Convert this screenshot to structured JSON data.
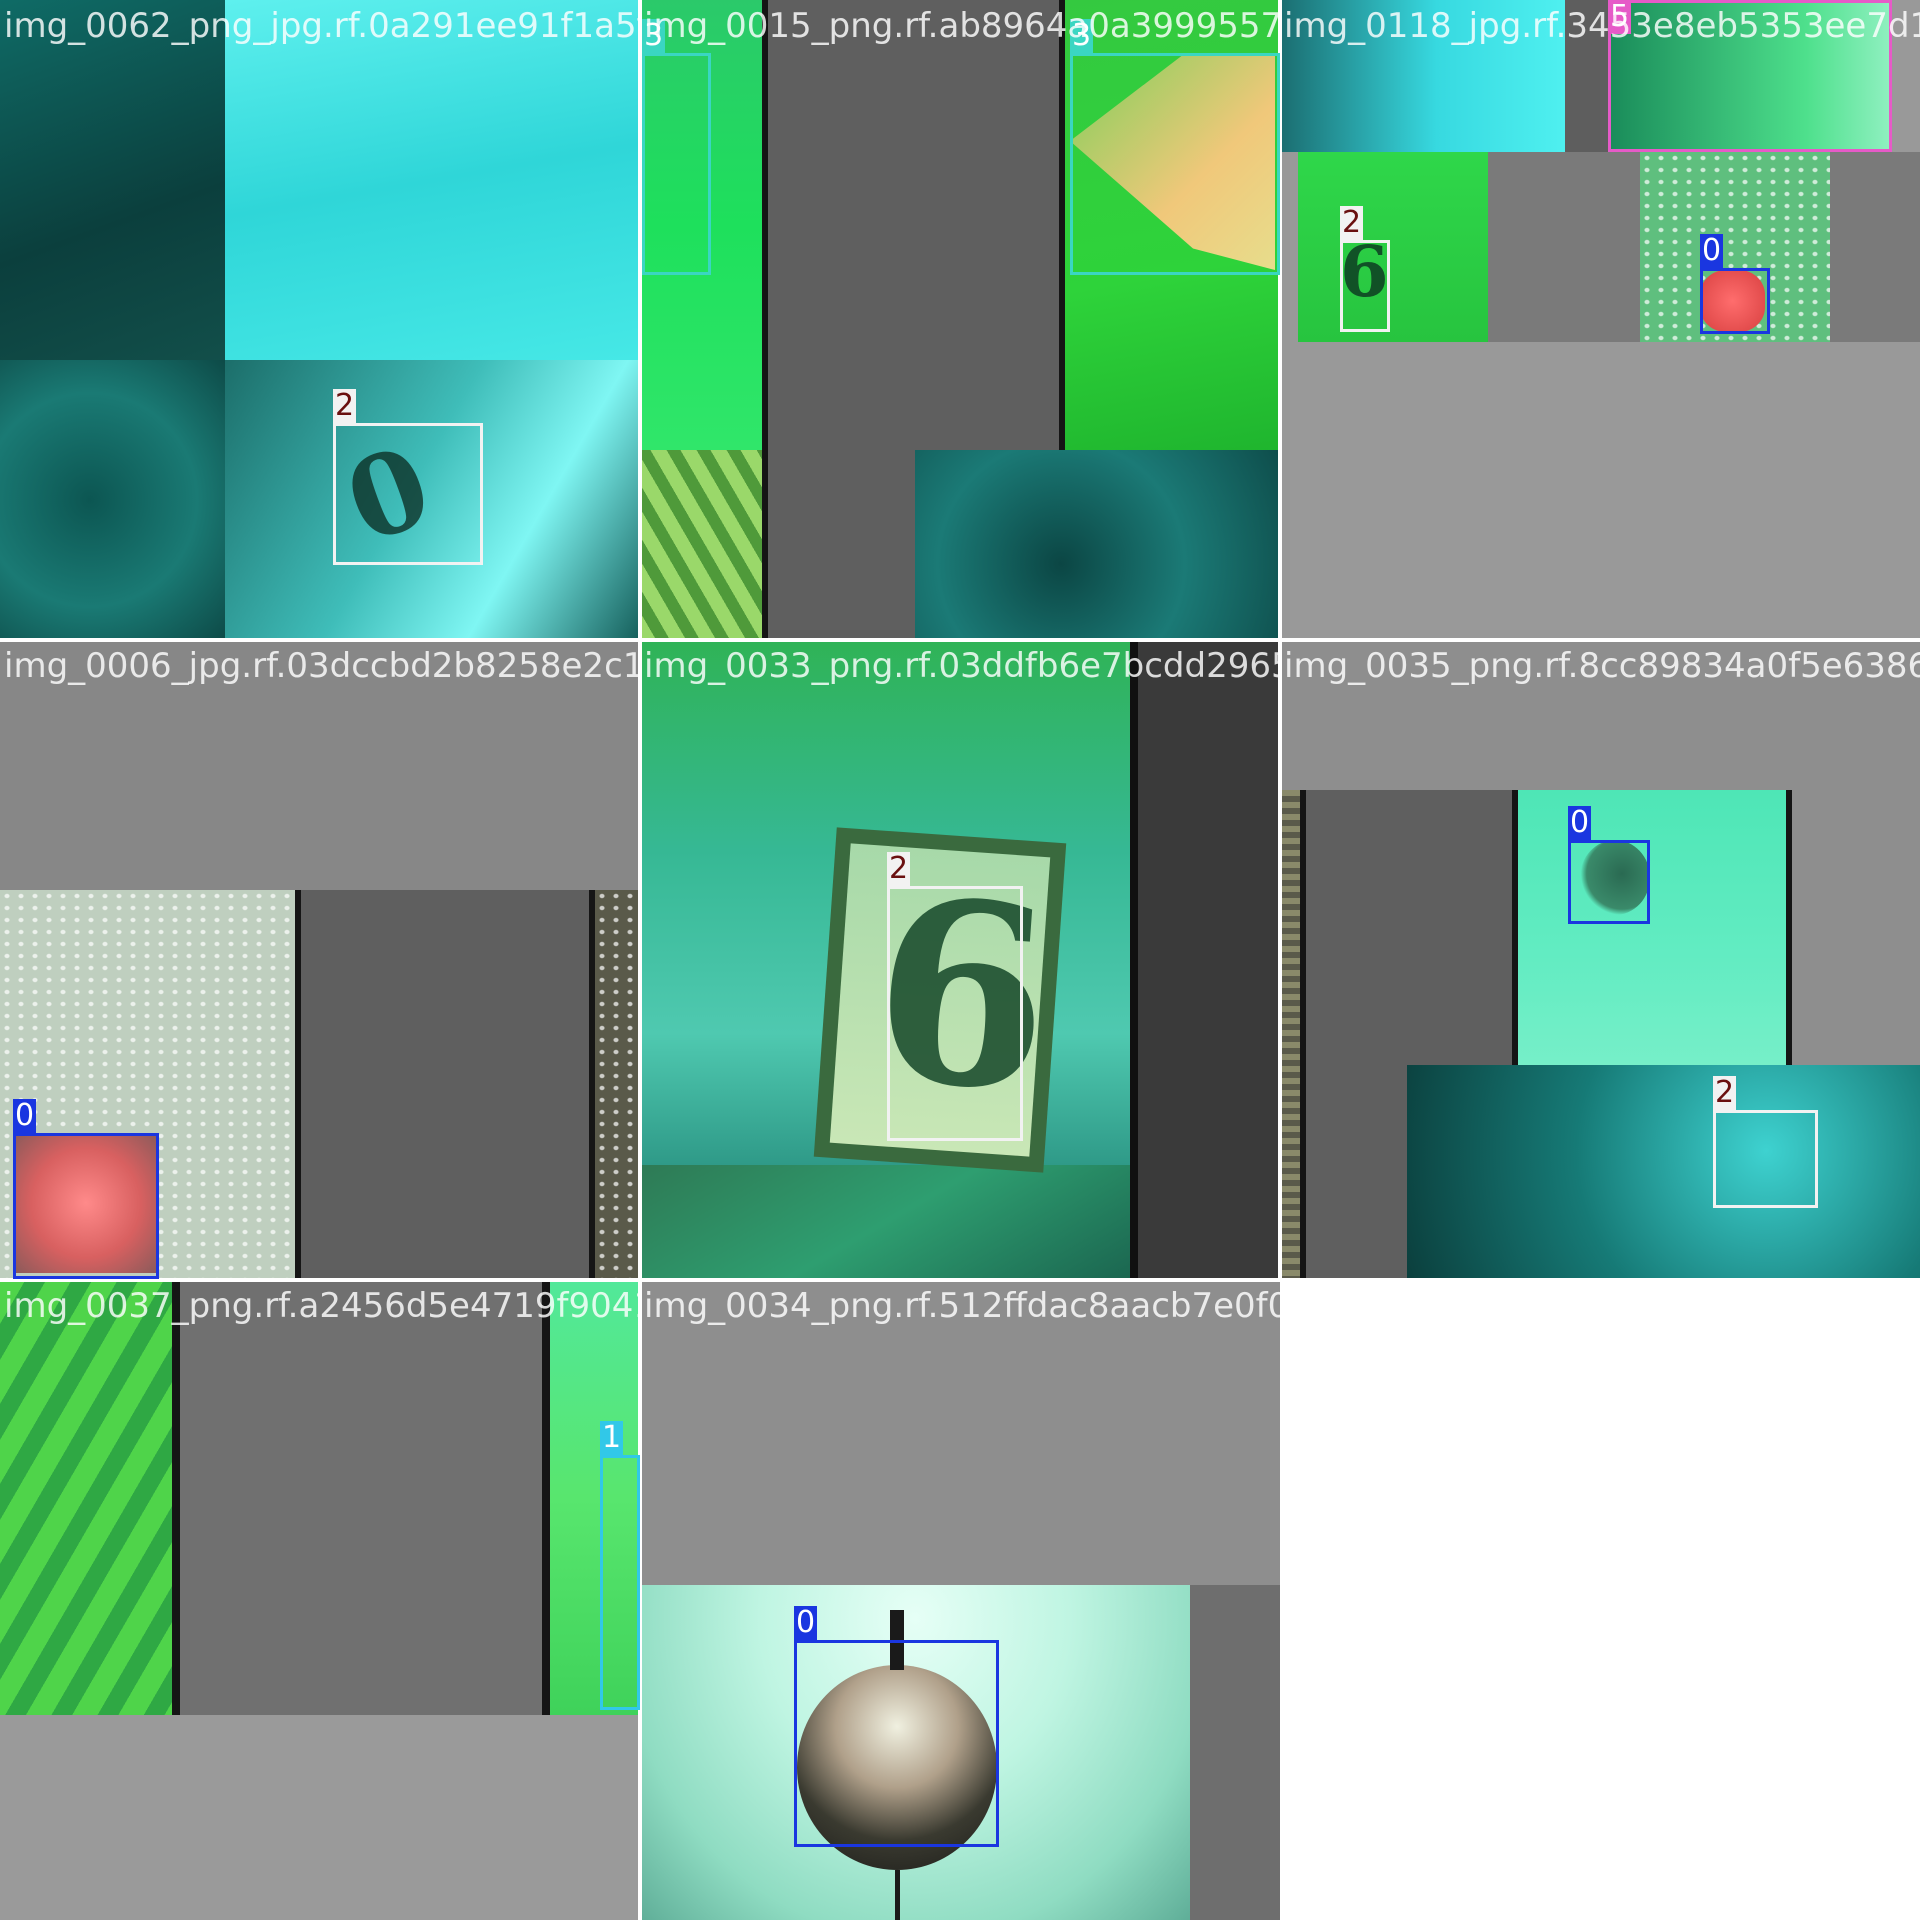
{
  "tiles": [
    {
      "filename": "img_0062_png_jpg.rf.0a291ee91f1a5f30c10"
    },
    {
      "filename": "img_0015_png.rf.ab8964a0a3999557e483f70"
    },
    {
      "filename": "img_0118_jpg.rf.3453e8eb5353ee7d1"
    },
    {
      "filename": "img_0006_jpg.rf.03dccbd2b8258e2c1de0890"
    },
    {
      "filename": "img_0033_png.rf.03ddfb6e7bcdd2965de6440"
    },
    {
      "filename": "img_0035_png.rf.8cc89834a0f5e6386"
    },
    {
      "filename": "img_0037_png.rf.a2456d5e4719f90410e3a03"
    },
    {
      "filename": "img_0034_png.rf.512ffdac8aacb7e0f09524e9"
    }
  ],
  "labels": {
    "class0": "0",
    "class1": "1",
    "class2": "2",
    "class3": "3",
    "class5": "5"
  },
  "class_colors": {
    "0": "#1a36e0",
    "1": "#31c8e8",
    "2": "#f2f2f2",
    "3": "#3ad6c2",
    "5": "#e65ac8"
  },
  "empty_tile": true
}
